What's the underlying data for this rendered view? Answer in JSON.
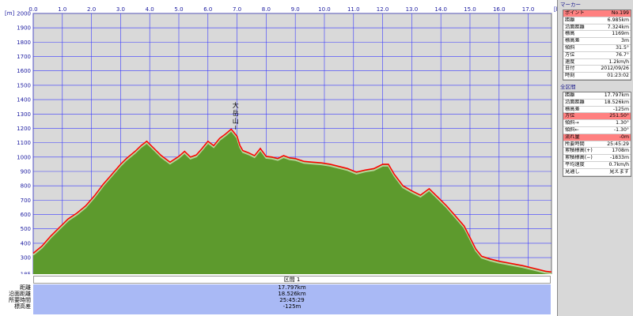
{
  "window": {
    "title": ""
  },
  "chart_data": {
    "type": "area",
    "x_unit": "km",
    "y_unit": "m",
    "xlim": [
      0,
      17.8
    ],
    "ylim": [
      185,
      2000
    ],
    "x_ticks": [
      "0.0",
      "1.0",
      "2.0",
      "3.0",
      "4.0",
      "5.0",
      "6.0",
      "7.0",
      "8.0",
      "9.0",
      "10.0",
      "11.0",
      "12.0",
      "13.0",
      "14.0",
      "15.0",
      "16.0",
      "17.0"
    ],
    "y_ticks": [
      "2000",
      "1900",
      "1800",
      "1700",
      "1600",
      "1500",
      "1400",
      "1300",
      "1200",
      "1100",
      "1000",
      "900",
      "800",
      "700",
      "600",
      "500",
      "400",
      "300",
      "185"
    ],
    "x": [
      0,
      0.3,
      0.6,
      0.9,
      1.2,
      1.5,
      1.8,
      2.1,
      2.4,
      2.7,
      3.0,
      3.2,
      3.5,
      3.7,
      3.9,
      4.1,
      4.4,
      4.7,
      5.0,
      5.2,
      5.4,
      5.6,
      5.8,
      6.0,
      6.2,
      6.4,
      6.6,
      6.8,
      6.9,
      7.0,
      7.1,
      7.2,
      7.4,
      7.6,
      7.8,
      8.0,
      8.2,
      8.4,
      8.6,
      8.8,
      9.0,
      9.3,
      9.6,
      9.9,
      10.2,
      10.5,
      10.8,
      11.1,
      11.4,
      11.7,
      12.0,
      12.2,
      12.4,
      12.7,
      13.0,
      13.3,
      13.6,
      13.9,
      14.2,
      14.5,
      14.8,
      15.0,
      15.2,
      15.4,
      15.7,
      16.0,
      16.4,
      16.8,
      17.2,
      17.6,
      17.797
    ],
    "y": [
      330,
      380,
      450,
      510,
      570,
      610,
      660,
      730,
      810,
      880,
      950,
      990,
      1040,
      1080,
      1110,
      1070,
      1010,
      965,
      1005,
      1040,
      1000,
      1015,
      1060,
      1110,
      1080,
      1130,
      1160,
      1195,
      1170,
      1145,
      1080,
      1045,
      1030,
      1010,
      1060,
      1005,
      1000,
      990,
      1010,
      995,
      990,
      970,
      965,
      960,
      950,
      935,
      920,
      895,
      910,
      920,
      950,
      950,
      880,
      800,
      765,
      735,
      780,
      720,
      660,
      590,
      520,
      440,
      360,
      310,
      290,
      275,
      260,
      245,
      225,
      205,
      200
    ],
    "series": [
      {
        "color": "#ff0000"
      },
      {
        "color": "#5d9a2d"
      }
    ],
    "annotations": [
      {
        "text": "大岳山",
        "x": 6.95
      }
    ]
  },
  "summary": {
    "header": "区間 1",
    "labels": [
      "距離",
      "沿面距離",
      "所要時間",
      "標高差"
    ],
    "values": [
      "17.797km",
      "18.526km",
      "25:45:29",
      "-125m"
    ]
  },
  "marker": {
    "title": "マーカー",
    "rows": [
      {
        "k": "ポイント",
        "v": "No.199",
        "hl": true
      },
      {
        "k": "距離",
        "v": "6.985km"
      },
      {
        "k": "沿面距離",
        "v": "7.324km"
      },
      {
        "k": "標高",
        "v": "1169m"
      },
      {
        "k": "標高差",
        "v": "3m"
      },
      {
        "k": "傾斜",
        "v": "31.5°"
      },
      {
        "k": "方位",
        "v": "76.7°"
      },
      {
        "k": "速度",
        "v": "1.2km/h"
      },
      {
        "k": "日付",
        "v": "2012/09/26"
      },
      {
        "k": "時刻",
        "v": "01:23:02"
      }
    ]
  },
  "total": {
    "title": "全区間",
    "rows": [
      {
        "k": "距離",
        "v": "17.797km"
      },
      {
        "k": "沿面距離",
        "v": "18.526km"
      },
      {
        "k": "標高差",
        "v": "-125m"
      },
      {
        "k": "方位",
        "v": "251.50°",
        "hl": true
      },
      {
        "k": "傾斜→",
        "v": "1.30°"
      },
      {
        "k": "傾斜←",
        "v": "-1.30°"
      },
      {
        "k": "流れ量",
        "v": "-0m",
        "hl": true
      },
      {
        "k": "所要時間",
        "v": "25:45:29"
      },
      {
        "k": "累積標高(+)",
        "v": "1708m"
      },
      {
        "k": "累積標高(−)",
        "v": "-1833m"
      },
      {
        "k": "平均速度",
        "v": "0.7km/h"
      },
      {
        "k": "見通し",
        "v": "見えます"
      }
    ]
  }
}
